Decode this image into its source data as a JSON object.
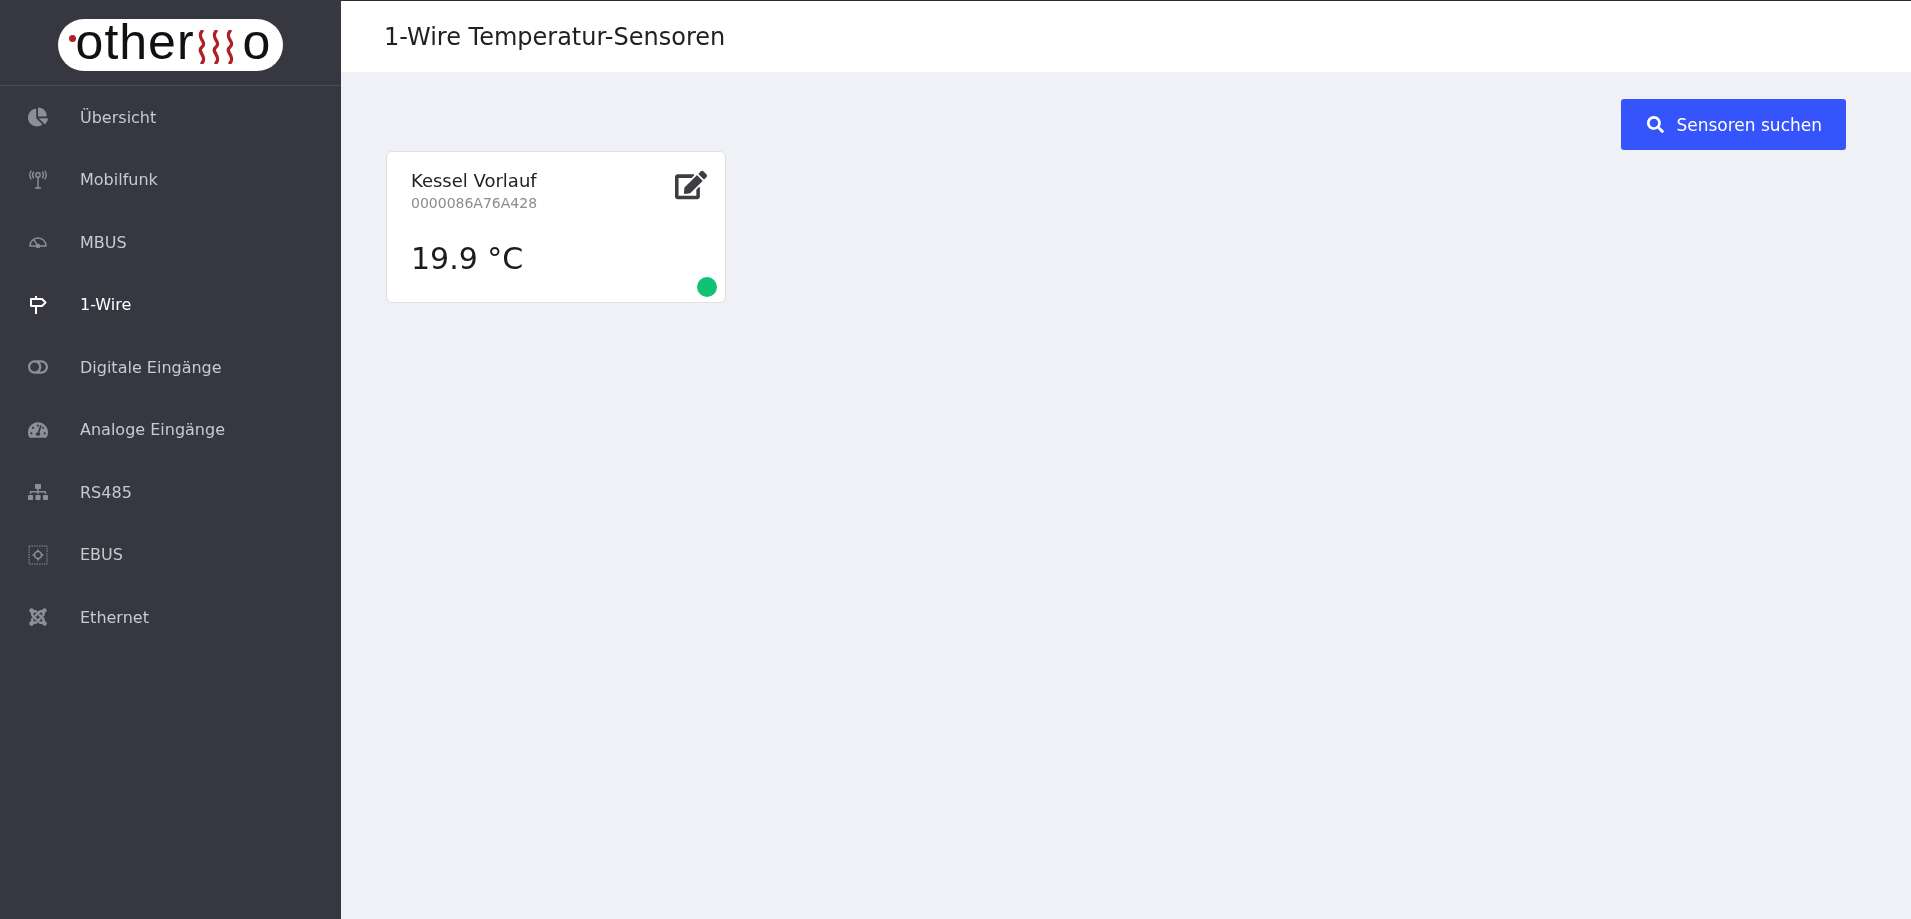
{
  "logo": {
    "prefix": "other",
    "suffix": "o"
  },
  "sidebar": {
    "items": [
      {
        "label": "Übersicht",
        "selected": false
      },
      {
        "label": "Mobilfunk",
        "selected": false
      },
      {
        "label": "MBUS",
        "selected": false
      },
      {
        "label": "1-Wire",
        "selected": true
      },
      {
        "label": "Digitale Eingänge",
        "selected": false
      },
      {
        "label": "Analoge Eingänge",
        "selected": false
      },
      {
        "label": "RS485",
        "selected": false
      },
      {
        "label": "EBUS",
        "selected": false
      },
      {
        "label": "Ethernet",
        "selected": false
      }
    ]
  },
  "header": {
    "title": "1-Wire Temperatur-Sensoren"
  },
  "toolbar": {
    "search_button": "Sensoren suchen"
  },
  "sensors": [
    {
      "name": "Kessel Vorlauf",
      "id": "0000086A76A428",
      "temperature": "19.9 °C",
      "color": "#12c274"
    }
  ]
}
